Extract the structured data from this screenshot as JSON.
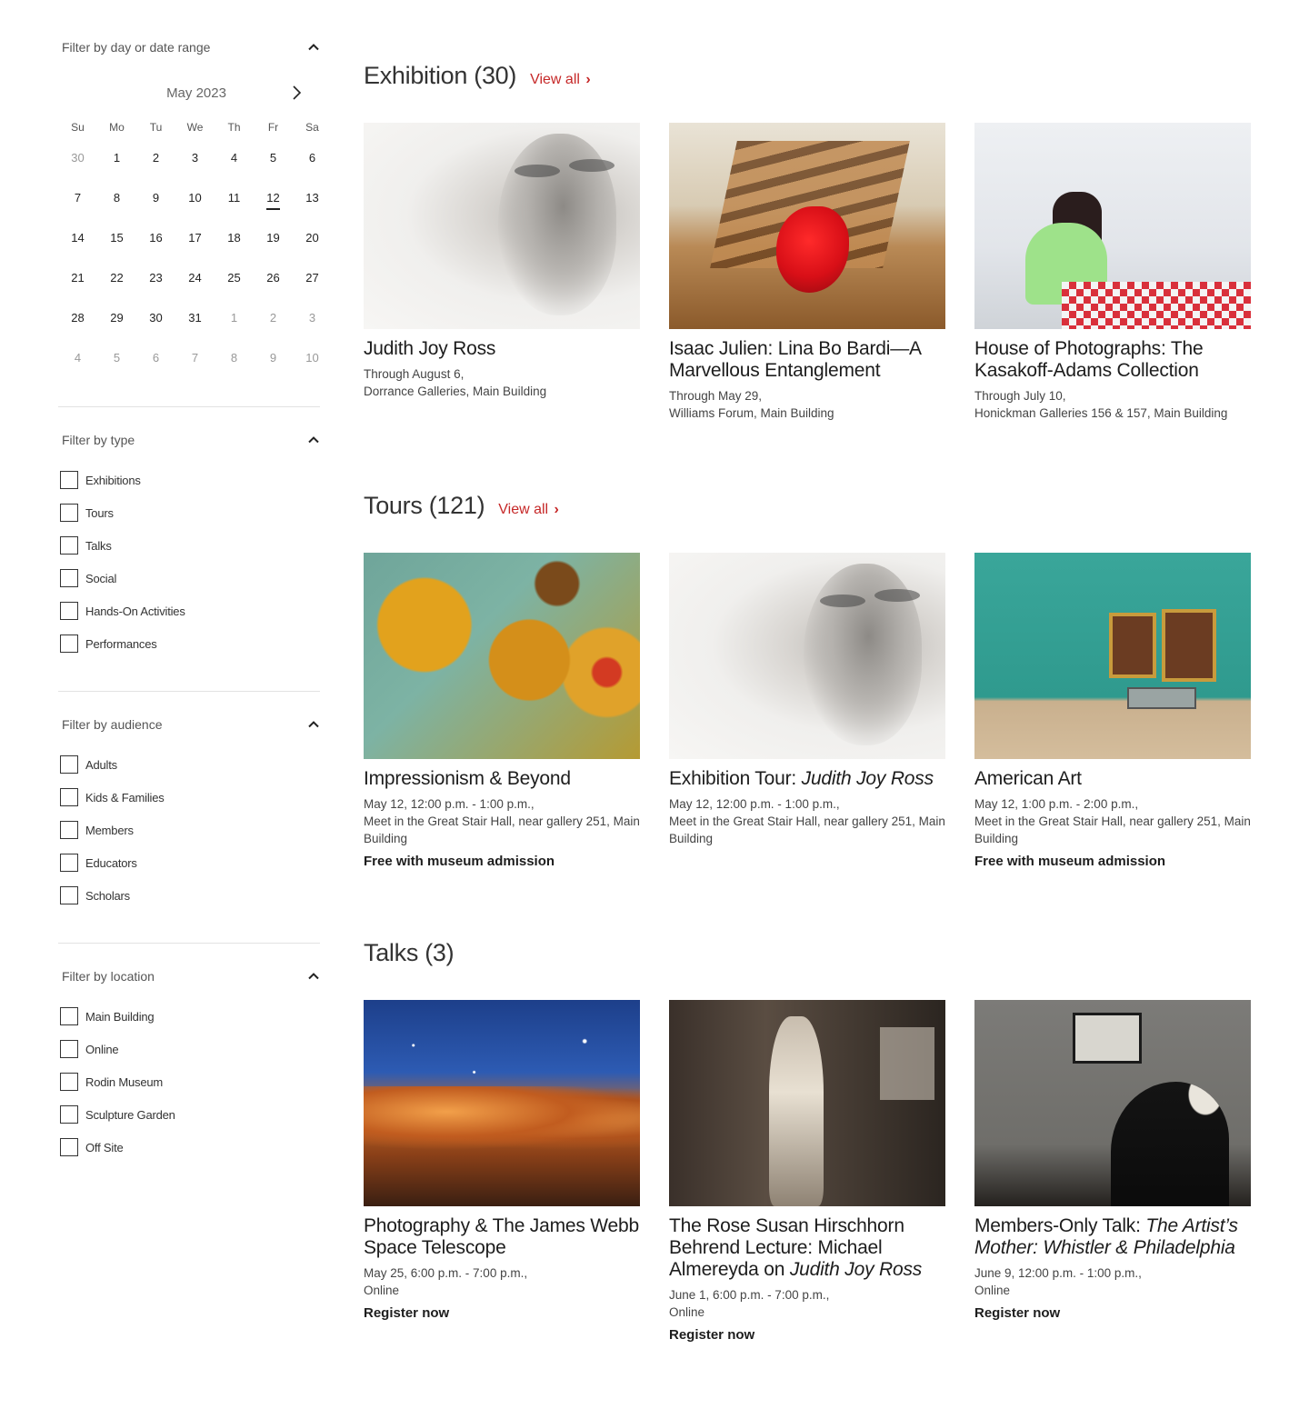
{
  "sidebar": {
    "date_filter": {
      "label": "Filter by day or date range",
      "month": "May 2023",
      "weekdays": [
        "Su",
        "Mo",
        "Tu",
        "We",
        "Th",
        "Fr",
        "Sa"
      ],
      "weeks": [
        [
          "30",
          "1",
          "2",
          "3",
          "4",
          "5",
          "6"
        ],
        [
          "7",
          "8",
          "9",
          "10",
          "11",
          "12",
          "13"
        ],
        [
          "14",
          "15",
          "16",
          "17",
          "18",
          "19",
          "20"
        ],
        [
          "21",
          "22",
          "23",
          "24",
          "25",
          "26",
          "27"
        ],
        [
          "28",
          "29",
          "30",
          "31",
          "1",
          "2",
          "3"
        ],
        [
          "4",
          "5",
          "6",
          "7",
          "8",
          "9",
          "10"
        ]
      ],
      "selected_day": "12"
    },
    "type_filter": {
      "label": "Filter by type",
      "options": [
        "Exhibitions",
        "Tours",
        "Talks",
        "Social",
        "Hands-On Activities",
        "Performances"
      ]
    },
    "audience_filter": {
      "label": "Filter by audience",
      "options": [
        "Adults",
        "Kids & Families",
        "Members",
        "Educators",
        "Scholars"
      ]
    },
    "location_filter": {
      "label": "Filter by location",
      "options": [
        "Main Building",
        "Online",
        "Rodin Museum",
        "Sculpture Garden",
        "Off Site"
      ]
    }
  },
  "sections": {
    "exhibition": {
      "title": "Exhibition (30)",
      "view_all": "View all",
      "cards": [
        {
          "title": "Judith Joy Ross",
          "date": "Through August 6,",
          "location": "Dorrance Galleries, Main Building"
        },
        {
          "title": "Isaac Julien: Lina Bo Bardi—A Marvellous Entanglement",
          "date": "Through May 29,",
          "location": "Williams Forum, Main Building"
        },
        {
          "title": "House of Photographs: The Kasakoff-Adams Collection",
          "date": "Through July 10,",
          "location": "Honickman Galleries 156 & 157, Main Building"
        }
      ]
    },
    "tours": {
      "title": "Tours (121)",
      "view_all": "View all",
      "cards": [
        {
          "title": "Impressionism & Beyond",
          "date": "May 12, 12:00 p.m. - 1:00 p.m.,",
          "location": "Meet in the Great Stair Hall, near gallery 251, Main Building",
          "price": "Free with museum admission"
        },
        {
          "title_prefix": "Exhibition Tour: ",
          "title_italic": "Judith Joy Ross",
          "date": "May 12, 12:00 p.m. - 1:00 p.m.,",
          "location": "Meet in the Great Stair Hall, near gallery 251, Main Building"
        },
        {
          "title": "American Art",
          "date": "May 12, 1:00 p.m. - 2:00 p.m.,",
          "location": "Meet in the Great Stair Hall, near gallery 251, Main Building",
          "price": "Free with museum admission"
        }
      ]
    },
    "talks": {
      "title": "Talks (3)",
      "cards": [
        {
          "title": "Photography & The James Webb Space Telescope",
          "date": "May 25, 6:00 p.m. - 7:00 p.m.,",
          "location": "Online",
          "cta": "Register now"
        },
        {
          "title_prefix": "The Rose Susan Hirschhorn Behrend Lecture: Michael Almereyda on ",
          "title_italic": "Judith Joy Ross",
          "date": "June 1, 6:00 p.m. - 7:00 p.m.,",
          "location": "Online",
          "cta": "Register now"
        },
        {
          "title_prefix": "Members-Only Talk: ",
          "title_italic": "The Artist’s Mother: Whistler & Philadelphia",
          "date": "June 9, 12:00 p.m. - 1:00 p.m.,",
          "location": "Online",
          "cta": "Register now"
        }
      ]
    }
  },
  "colors": {
    "accent": "#c62828",
    "text": "#1d1d1d",
    "muted": "#999999",
    "divider": "#e2e2e2"
  },
  "icons": {
    "collapse": "chevron-up-icon",
    "next_month": "chevron-right-icon",
    "view_all_arrow": "chevron-right-icon"
  }
}
